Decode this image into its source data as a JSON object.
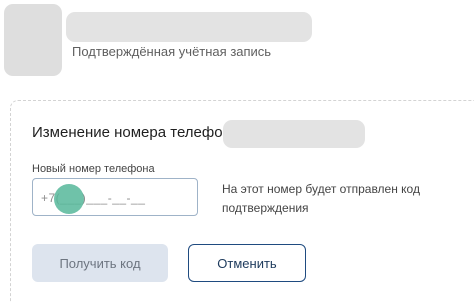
{
  "header": {
    "account_status": "Подтверждённая учётная запись"
  },
  "phone_change": {
    "title": "Изменение номера телефона",
    "field_label": "Новый номер телефона",
    "field_placeholder": "+7(___)___-__-__",
    "hint": "На этот номер будет отправлен код подтверждения",
    "get_code_label": "Получить код",
    "cancel_label": "Отменить"
  },
  "colors": {
    "accent": "#1f4b80",
    "disabled_button": "#dde4ee",
    "touch_indicator": "#56b79a"
  }
}
